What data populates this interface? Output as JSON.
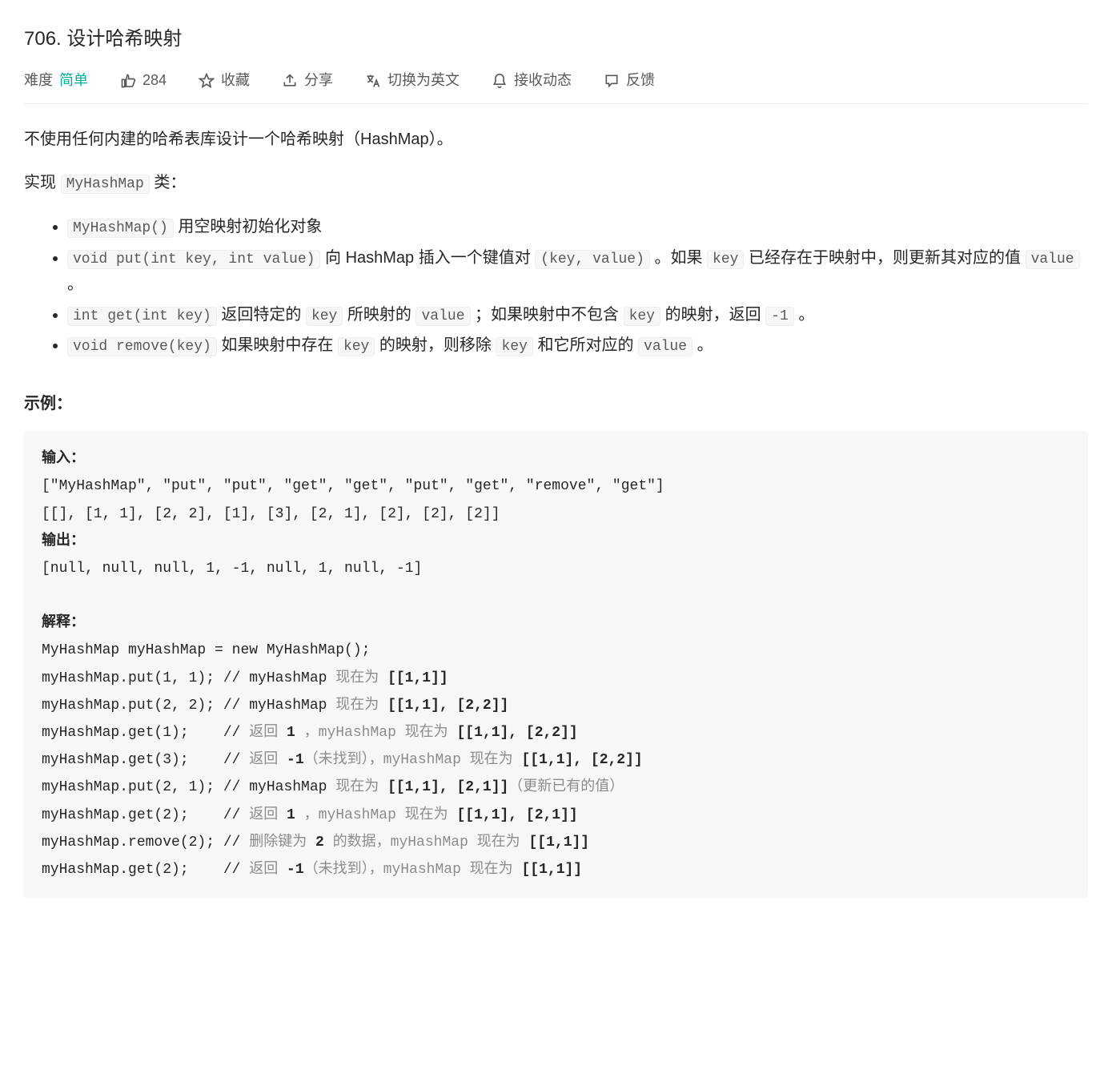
{
  "title": "706. 设计哈希映射",
  "meta": {
    "difficulty_label": "难度",
    "difficulty_value": "简单",
    "likes": "284",
    "favorite": "收藏",
    "share": "分享",
    "switch_lang": "切换为英文",
    "subscribe": "接收动态",
    "feedback": "反馈"
  },
  "desc": {
    "intro": "不使用任何内建的哈希表库设计一个哈希映射（HashMap）。",
    "implement_prefix": "实现 ",
    "implement_class": "MyHashMap",
    "implement_suffix": " 类：",
    "items": {
      "ctor_code": "MyHashMap()",
      "ctor_text": " 用空映射初始化对象",
      "put_code": "void put(int key, int value)",
      "put_t1": " 向 HashMap 插入一个键值对 ",
      "put_kv": "(key, value)",
      "put_t2": " 。如果 ",
      "put_key": "key",
      "put_t3": " 已经存在于映射中，则更新其对应的值 ",
      "put_val": "value",
      "put_t4": " 。",
      "get_code": "int get(int key)",
      "get_t1": " 返回特定的 ",
      "get_key": "key",
      "get_t2": " 所映射的 ",
      "get_val": "value",
      "get_t3": " ；如果映射中不包含 ",
      "get_key2": "key",
      "get_t4": " 的映射，返回 ",
      "get_neg1": "-1",
      "get_t5": " 。",
      "rm_code": "void remove(key)",
      "rm_t1": " 如果映射中存在 ",
      "rm_key": "key",
      "rm_t2": " 的映射，则移除 ",
      "rm_key2": "key",
      "rm_t3": " 和它所对应的 ",
      "rm_val": "value",
      "rm_t4": " 。"
    }
  },
  "example": {
    "header": "示例：",
    "input_label": "输入：",
    "input_l1": "[\"MyHashMap\", \"put\", \"put\", \"get\", \"get\", \"put\", \"get\", \"remove\", \"get\"]",
    "input_l2": "[[], [1, 1], [2, 2], [1], [3], [2, 1], [2], [2], [2]]",
    "output_label": "输出：",
    "output_l1": "[null, null, null, 1, -1, null, 1, null, -1]",
    "explain_label": "解释：",
    "e0": "MyHashMap myHashMap = new MyHashMap();",
    "e1a": "myHashMap.put(1, 1); // myHashMap ",
    "e1b": "现在为",
    "e1c": " [[1,1]]",
    "e2a": "myHashMap.put(2, 2); // myHashMap ",
    "e2b": "现在为",
    "e2c": " [[1,1], [2,2]]",
    "e3a": "myHashMap.get(1);    // ",
    "e3b": "返回",
    "e3c": " 1 ",
    "e3d": "，myHashMap 现在为",
    "e3e": " [[1,1], [2,2]]",
    "e4a": "myHashMap.get(3);    // ",
    "e4b": "返回",
    "e4c": " -1",
    "e4d": "（未找到），myHashMap 现在为",
    "e4e": " [[1,1], [2,2]]",
    "e5a": "myHashMap.put(2, 1); // myHashMap ",
    "e5b": "现在为",
    "e5c": " [[1,1], [2,1]]",
    "e5d": "（更新已有的值）",
    "e6a": "myHashMap.get(2);    // ",
    "e6b": "返回",
    "e6c": " 1 ",
    "e6d": "，myHashMap 现在为",
    "e6e": " [[1,1], [2,1]]",
    "e7a": "myHashMap.remove(2); // ",
    "e7b": "删除键为",
    "e7c": " 2 ",
    "e7d": "的数据，myHashMap 现在为",
    "e7e": " [[1,1]]",
    "e8a": "myHashMap.get(2);    // ",
    "e8b": "返回",
    "e8c": " -1",
    "e8d": "（未找到），myHashMap 现在为",
    "e8e": " [[1,1]]"
  }
}
